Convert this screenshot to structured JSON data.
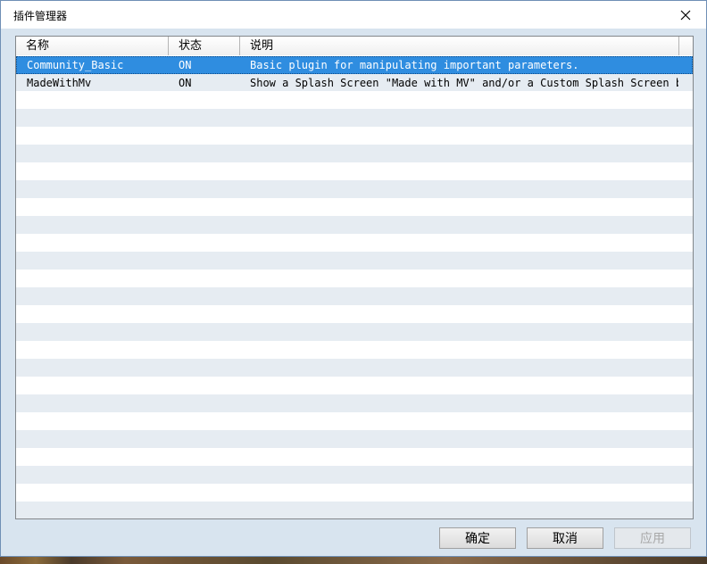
{
  "window": {
    "title": "插件管理器"
  },
  "columns": [
    {
      "label": "名称"
    },
    {
      "label": "状态"
    },
    {
      "label": "说明"
    }
  ],
  "plugins": [
    {
      "name": "Community_Basic",
      "status": "ON",
      "description": "Basic plugin for manipulating important parameters.",
      "selected": true
    },
    {
      "name": "MadeWithMv",
      "status": "ON",
      "description": "Show a Splash Screen \"Made with MV\" and/or a Custom Splash Screen be…",
      "selected": false
    }
  ],
  "buttons": {
    "ok": "确定",
    "cancel": "取消",
    "apply": "应用"
  },
  "colors": {
    "selection": "#2f8de0",
    "row_alt": "#e6ecf2",
    "dialog_bg": "#d8e4ef"
  }
}
